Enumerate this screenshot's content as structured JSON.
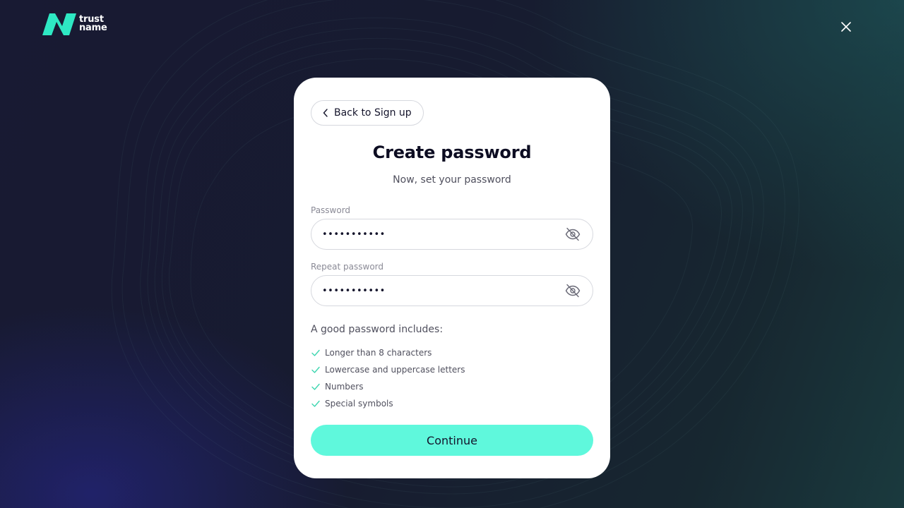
{
  "brand": {
    "name_line1": "trust",
    "name_line2": "name",
    "logo_icon": "trustname-logo-icon",
    "accent_color": "#2ee8c3"
  },
  "header": {
    "close_icon": "close-icon"
  },
  "card": {
    "back_label": "Back to Sign up",
    "back_icon": "chevron-left-icon",
    "title": "Create password",
    "subtitle": "Now, set your password",
    "password": {
      "label": "Password",
      "value": "•••••••••••",
      "toggle_icon": "eye-off-icon"
    },
    "repeat_password": {
      "label": "Repeat password",
      "value": "•••••••••••",
      "toggle_icon": "eye-off-icon"
    },
    "rules_title": "A good password includes:",
    "rules": [
      {
        "label": "Longer than 8 characters",
        "icon": "check-icon"
      },
      {
        "label": "Lowercase and uppercase letters",
        "icon": "check-icon"
      },
      {
        "label": "Numbers",
        "icon": "check-icon"
      },
      {
        "label": "Special symbols",
        "icon": "check-icon"
      }
    ],
    "continue_label": "Continue",
    "continue_color": "#5ff8dc",
    "check_color": "#3fd6b0"
  }
}
